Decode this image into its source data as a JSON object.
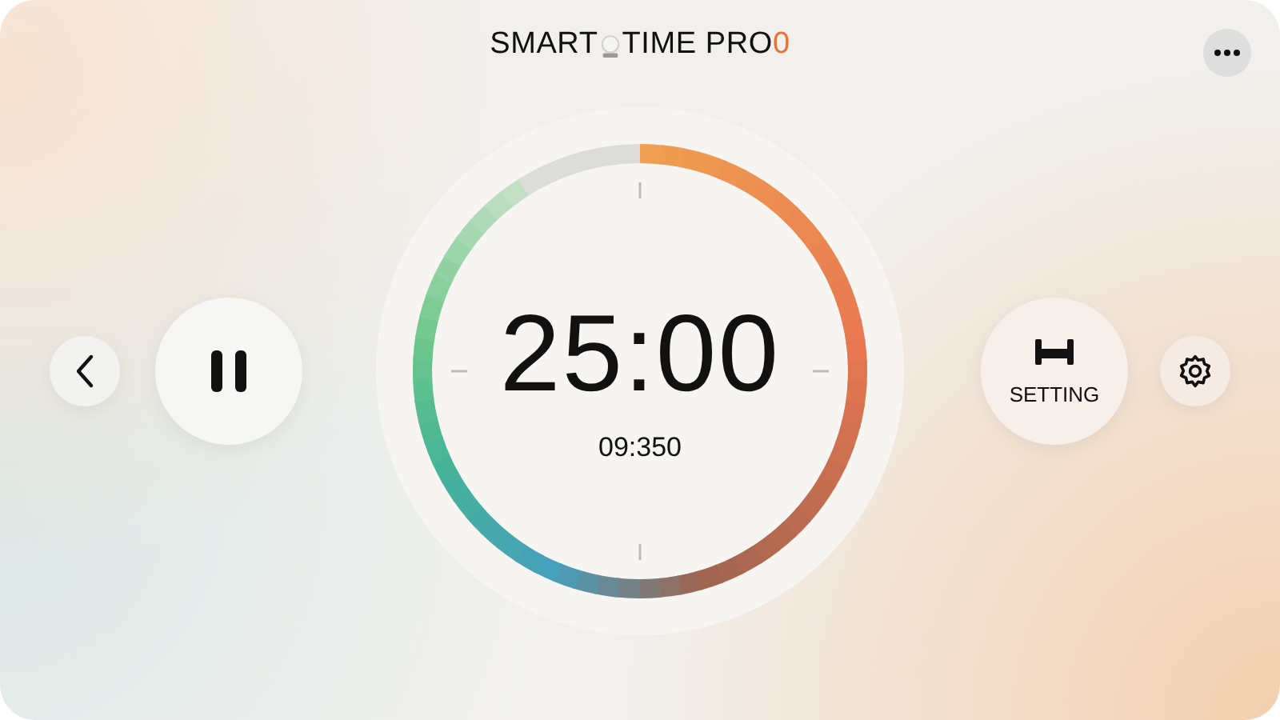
{
  "header": {
    "title_start": "SMART",
    "title_end": "TIME PRO",
    "title_suffix": "0"
  },
  "timer": {
    "time": "25:00",
    "subtime": "09:350",
    "paused": false
  },
  "setting_button": {
    "label": "SETTING"
  }
}
